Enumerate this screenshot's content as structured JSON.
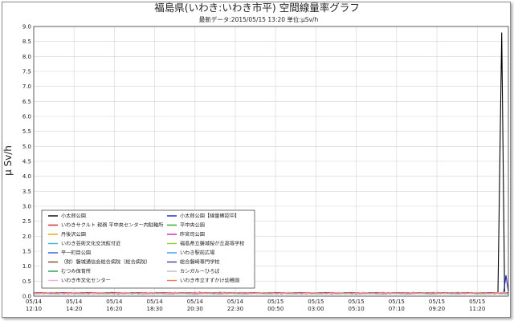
{
  "chart_data": {
    "type": "line",
    "title": "福島県(いわき:いわき市平) 空間線量率グラフ",
    "subtitle_latest_label": "最新データ",
    "subtitle_latest_value": "2015/05/15 13:20",
    "subtitle_unit_label": "単位",
    "subtitle_unit_value": "μSv/h",
    "ylabel": "μ Sv/h",
    "ylim": [
      0,
      9.0
    ],
    "yticks": [
      "0.0",
      "0.5",
      "1.0",
      "1.5",
      "2.0",
      "2.5",
      "3.0",
      "3.5",
      "4.0",
      "4.5",
      "5.0",
      "5.5",
      "6.0",
      "6.5",
      "7.0",
      "7.5",
      "8.0",
      "8.5",
      "9.0"
    ],
    "xticks": [
      {
        "date": "05/14",
        "time": "12:10"
      },
      {
        "date": "05/14",
        "time": "14:20"
      },
      {
        "date": "05/14",
        "time": "16:20"
      },
      {
        "date": "05/14",
        "time": "18:30"
      },
      {
        "date": "05/14",
        "time": "20:30"
      },
      {
        "date": "05/14",
        "time": "22:30"
      },
      {
        "date": "05/15",
        "time": "00:50"
      },
      {
        "date": "05/15",
        "time": "03:00"
      },
      {
        "date": "05/15",
        "time": "05:10"
      },
      {
        "date": "05/15",
        "time": "07:10"
      },
      {
        "date": "05/15",
        "time": "09:20"
      },
      {
        "date": "05/15",
        "time": "11:20"
      }
    ],
    "legend_position": "lower-left",
    "grid": true,
    "baseline_value": 0.1,
    "series": [
      {
        "name": "小太郎公園",
        "color": "#000000",
        "spike": {
          "peak": 8.8,
          "rise_x": 0.978,
          "peak_x": 0.986
        }
      },
      {
        "name": "小太郎公園【線量確認中】",
        "color": "#1c1cc8",
        "spike": {
          "peak": 0.7,
          "rise_x": 0.99,
          "peak_x": 0.995
        }
      },
      {
        "name": "いわきサクルト 税務 平中央センター内駐輪所",
        "color": "#dd2222"
      },
      {
        "name": "平中央公園",
        "color": "#22aa22"
      },
      {
        "name": "丹後沢公園",
        "color": "#e6a600"
      },
      {
        "name": "昨宮司公園",
        "color": "#cc22cc"
      },
      {
        "name": "いわき芸術文化交流館付近",
        "color": "#33bbcc"
      },
      {
        "name": "福島県立磐城桜が丘高等学校",
        "color": "#99cc33"
      },
      {
        "name": "平一町目公園",
        "color": "#3355dd"
      },
      {
        "name": "いわき駅前広場",
        "color": "#3399ff"
      },
      {
        "name": "（財）磐城通信会総合病院（総合病院）",
        "color": "#884422"
      },
      {
        "name": "総合磐崎専門学校",
        "color": "#553399"
      },
      {
        "name": "むつみ保育所",
        "color": "#229955"
      },
      {
        "name": "カンガルーひろば",
        "color": "#bbbbbb"
      },
      {
        "name": "いわき市文化センター",
        "color": "#ffaadd"
      },
      {
        "name": "いわき市立すずかけ幼稚園",
        "color": "#ff7755"
      }
    ]
  }
}
